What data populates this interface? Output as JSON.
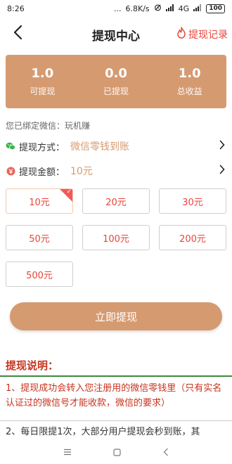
{
  "status_bar": {
    "time": "8:26",
    "dots": "...",
    "speed": "6.8K/s",
    "network": "4G",
    "battery": "100"
  },
  "header": {
    "title": "提现中心",
    "record_label": "提现记录"
  },
  "summary": [
    {
      "value": "1.0",
      "label": "可提现"
    },
    {
      "value": "0.0",
      "label": "已提现"
    },
    {
      "value": "1.0",
      "label": "总收益"
    }
  ],
  "bound_info": "您已绑定微信：玩机赚",
  "method_row": {
    "label": "提现方式：",
    "value": "微信零钱到账"
  },
  "amount_row": {
    "label": "提现金额：",
    "value": "10元"
  },
  "amounts": [
    {
      "label": "10元",
      "selected": true
    },
    {
      "label": "20元"
    },
    {
      "label": "30元"
    },
    {
      "label": "50元"
    },
    {
      "label": "100元"
    },
    {
      "label": "200元"
    },
    {
      "label": "500元"
    }
  ],
  "submit_label": "立即提现",
  "notes": {
    "title": "提现说明：",
    "line1": "1、提现成功会转入您注册用的微信零钱里（只有实名认证过的微信号才能收款，微信的要求）",
    "line2": "2、每日限提1次，大部分用户提现会秒到账，其"
  },
  "colors": {
    "accent": "#d69a70",
    "red": "#e8453c",
    "note_red": "#c8331e",
    "divider_green": "#3b8a3a"
  },
  "icons": {
    "back": "chevron-left-icon",
    "record": "flame-icon",
    "wechat": "wechat-icon",
    "money": "yen-coin-icon",
    "arrow": "chevron-right-icon"
  }
}
